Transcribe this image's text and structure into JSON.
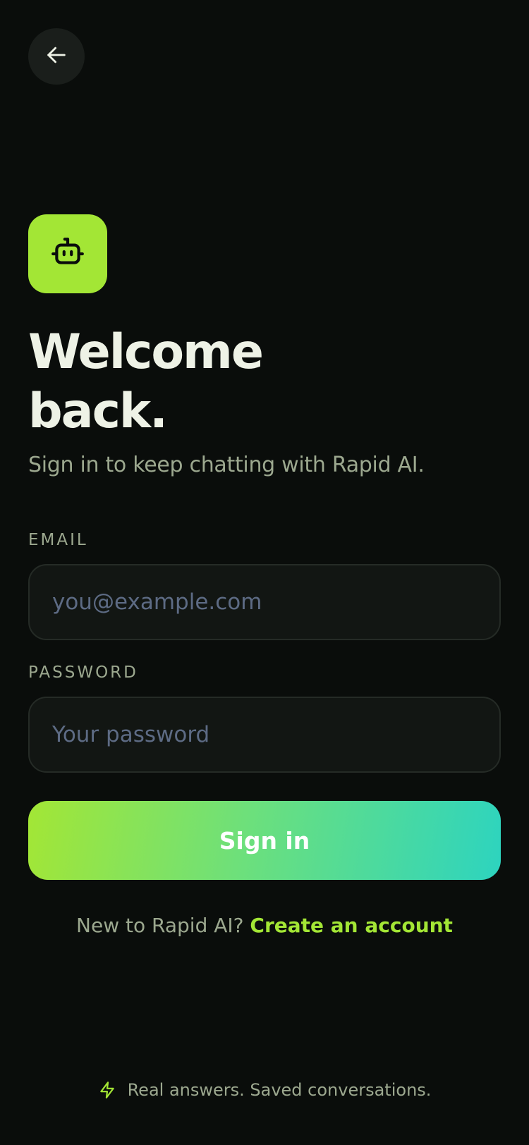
{
  "header": {
    "back_icon": "arrow-left-icon"
  },
  "brand": {
    "logo_icon": "robot-icon",
    "accent_color": "#a3e635",
    "gradient_end_color": "#2dd4bf"
  },
  "hero": {
    "title_line1": "Welcome",
    "title_line2": "back.",
    "subtitle": "Sign in to keep chatting with Rapid AI."
  },
  "form": {
    "email": {
      "label": "EMAIL",
      "placeholder": "you@example.com",
      "value": ""
    },
    "password": {
      "label": "PASSWORD",
      "placeholder": "Your password",
      "value": ""
    },
    "submit_label": "Sign in"
  },
  "signup": {
    "prompt": "New to Rapid AI?",
    "link_label": "Create an account"
  },
  "footer": {
    "icon": "lightning-bolt-icon",
    "tagline": "Real answers. Saved conversations."
  }
}
